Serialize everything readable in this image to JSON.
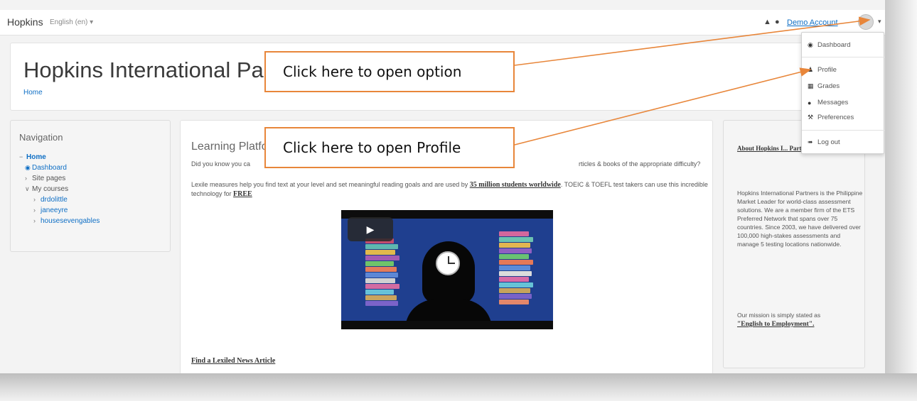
{
  "navbar": {
    "brand": "Hopkins",
    "language": "English (en) ▾",
    "user_name": "Demo Account",
    "caret": "▾"
  },
  "header": {
    "title": "Hopkins International Partners",
    "breadcrumb": "Home"
  },
  "navigation": {
    "title": "Navigation",
    "home": "Home",
    "dashboard": "Dashboard",
    "site_pages": "Site pages",
    "my_courses": "My courses",
    "courses": [
      "drdolittle",
      "janeeyre",
      "housesevengables"
    ]
  },
  "main": {
    "title": "Learning Platfo",
    "p1_left": "Did you know you ca",
    "p1_right": "rticles & books of the appropriate difficulty?",
    "p2_a": "Lexile measures help you find text at your level and set meaningful reading goals and are used by ",
    "p2_bold": "35 million students worldwide",
    "p2_b": ". TOEIC & TOEFL test takers can use this incredible technology for ",
    "p2_free": "FREE",
    "news_link": "Find a Lexiled News Article"
  },
  "about": {
    "title": "About Hopkins I... Partners",
    "text": "Hopkins International Partners is the Philippine Market Leader for world-class assessment solutions. We are a member firm of the ETS Preferred Network that spans over 75 countries. Since 2003, we have delivered over 100,000 high-stakes assessments and manage 5 testing locations nationwide.",
    "mission_prefix": "Our mission is simply stated as ",
    "mission_bold": "\"English to Employment\"."
  },
  "user_menu": {
    "items": [
      {
        "label": "Dashboard",
        "icon": "dashboard-icon"
      },
      {
        "label": "Profile",
        "icon": "user-icon"
      },
      {
        "label": "Grades",
        "icon": "grades-icon"
      },
      {
        "label": "Messages",
        "icon": "message-icon"
      },
      {
        "label": "Preferences",
        "icon": "wrench-icon"
      },
      {
        "label": "Log out",
        "icon": "logout-icon"
      }
    ]
  },
  "callouts": {
    "option": "Click here to open option",
    "profile": "Click here to open Profile"
  },
  "colors": {
    "link": "#0f6fc5",
    "callout_border": "#e8863a",
    "page_bg": "#f3f3f3"
  }
}
